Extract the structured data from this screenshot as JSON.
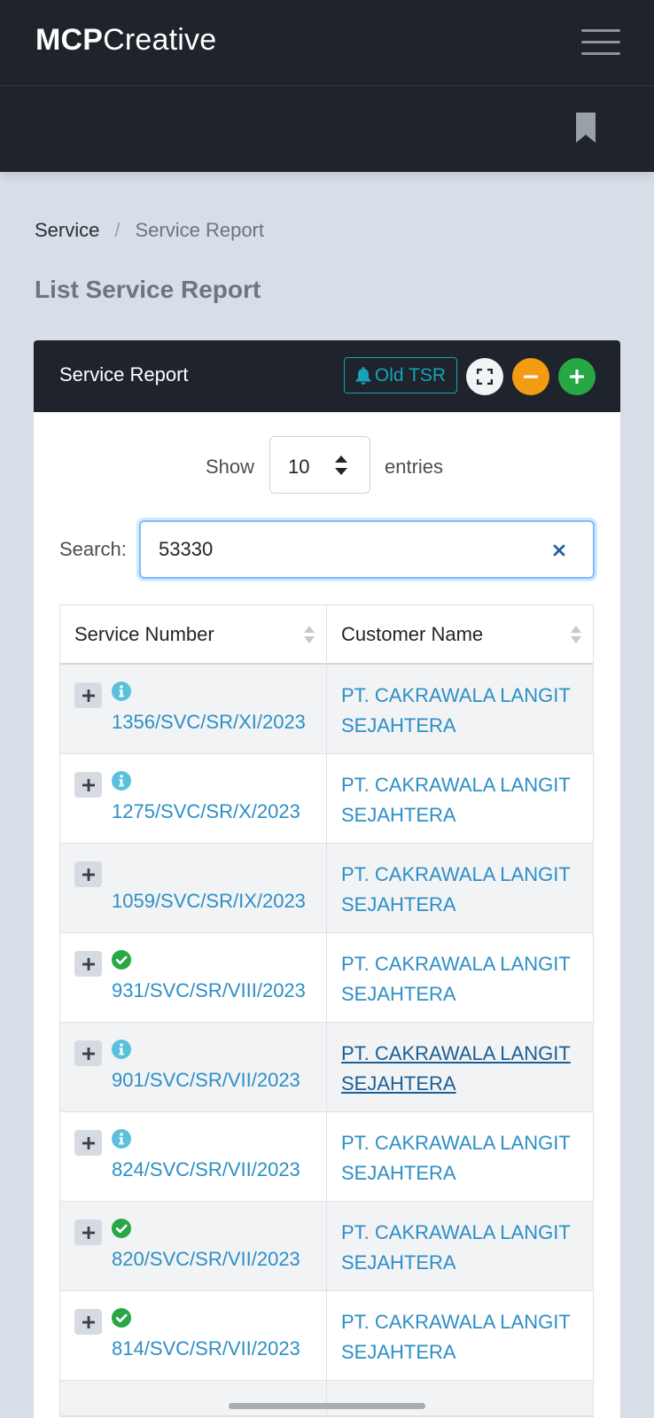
{
  "app": {
    "logo_bold": "MCP",
    "logo_light": "Creative"
  },
  "breadcrumb": {
    "parent": "Service",
    "separator": "/",
    "current": "Service Report"
  },
  "page": {
    "title": "List Service Report"
  },
  "card": {
    "title": "Service Report",
    "old_tsr_label": "Old TSR",
    "accent_colors": {
      "old_tsr": "#17a2b8",
      "collapse": "#f39c12",
      "add": "#28a745"
    }
  },
  "table_controls": {
    "show_label": "Show",
    "entries_value": "10",
    "entries_label": "entries",
    "search_label": "Search:",
    "search_value": "53330"
  },
  "table": {
    "columns": [
      "Service Number",
      "Customer Name"
    ],
    "rows": [
      {
        "service_number": "1356/SVC/SR/XI/2023",
        "customer": "PT. CAKRAWALA LANGIT SEJAHTERA",
        "status_icon": "info-icon"
      },
      {
        "service_number": "1275/SVC/SR/X/2023",
        "customer": "PT. CAKRAWALA LANGIT SEJAHTERA",
        "status_icon": "info-icon"
      },
      {
        "service_number": "1059/SVC/SR/IX/2023",
        "customer": "PT. CAKRAWALA LANGIT SEJAHTERA",
        "status_icon": "none"
      },
      {
        "service_number": "931/SVC/SR/VIII/2023",
        "customer": "PT. CAKRAWALA LANGIT SEJAHTERA",
        "status_icon": "check-circle-icon"
      },
      {
        "service_number": "901/SVC/SR/VII/2023",
        "customer": "PT. CAKRAWALA LANGIT SEJAHTERA",
        "status_icon": "info-icon"
      },
      {
        "service_number": "824/SVC/SR/VII/2023",
        "customer": "PT. CAKRAWALA LANGIT SEJAHTERA",
        "status_icon": "info-icon"
      },
      {
        "service_number": "820/SVC/SR/VII/2023",
        "customer": "PT. CAKRAWALA LANGIT SEJAHTERA",
        "status_icon": "check-circle-icon"
      },
      {
        "service_number": "814/SVC/SR/VII/2023",
        "customer": "PT. CAKRAWALA LANGIT SEJAHTERA",
        "status_icon": "check-circle-icon"
      }
    ]
  },
  "status_colors": {
    "info": "#5bc0de",
    "check": "#28a745",
    "link": "#2d8fc6"
  }
}
